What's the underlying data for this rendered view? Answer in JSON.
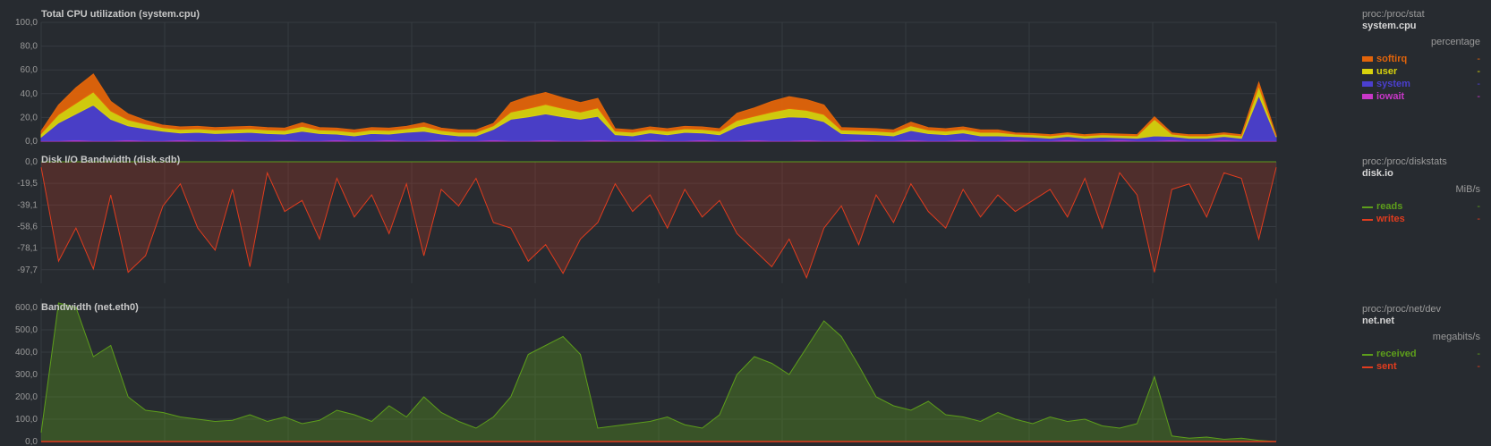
{
  "colors": {
    "background": "#272b30",
    "grid": "#363b41",
    "softirq": "#e2640a",
    "user": "#d8d20d",
    "system": "#4b3fcf",
    "iowait": "#c837c8",
    "reads": "#5d9e1b",
    "writes": "#e13c1e",
    "received": "#5d9e1b",
    "sent": "#e13c1e"
  },
  "charts": [
    {
      "id": "system.cpu",
      "title": "Total CPU utilization (system.cpu)",
      "legend": {
        "context": "proc:/proc/stat",
        "chart": "system.cpu",
        "units": "percentage",
        "dims": [
          {
            "label": "softirq",
            "value": "-",
            "color": "#e2640a"
          },
          {
            "label": "user",
            "value": "-",
            "color": "#d8d20d"
          },
          {
            "label": "system",
            "value": "-",
            "color": "#4b3fcf"
          },
          {
            "label": "iowait",
            "value": "-",
            "color": "#c837c8"
          }
        ]
      },
      "y_ticks": [
        "100,0",
        "80,0",
        "60,0",
        "40,0",
        "20,0",
        "0,0"
      ]
    },
    {
      "id": "disk.io",
      "title": "Disk I/O Bandwidth (disk.sdb)",
      "legend": {
        "context": "proc:/proc/diskstats",
        "chart": "disk.io",
        "units": "MiB/s",
        "dims": [
          {
            "label": "reads",
            "value": "-",
            "color": "#5d9e1b"
          },
          {
            "label": "writes",
            "value": "-",
            "color": "#e13c1e"
          }
        ]
      },
      "y_ticks": [
        "0,0",
        "-19,5",
        "-39,1",
        "-58,6",
        "-78,1",
        "-97,7"
      ]
    },
    {
      "id": "net.net",
      "title": "Bandwidth (net.eth0)",
      "legend": {
        "context": "proc:/proc/net/dev",
        "chart": "net.net",
        "units": "megabits/s",
        "dims": [
          {
            "label": "received",
            "value": "-",
            "color": "#5d9e1b"
          },
          {
            "label": "sent",
            "value": "-",
            "color": "#e13c1e"
          }
        ]
      },
      "y_ticks": [
        "600,0",
        "500,0",
        "400,0",
        "300,0",
        "200,0",
        "100,0",
        "0,0"
      ]
    }
  ],
  "chart_data": [
    {
      "type": "area",
      "title": "Total CPU utilization (system.cpu)",
      "ylabel": "percentage",
      "ylim": [
        0,
        100
      ],
      "stacked": true,
      "series": [
        {
          "name": "iowait",
          "values": [
            0.5,
            0.5,
            1,
            0.5,
            0.5,
            1,
            0.5,
            0.5,
            1,
            0.5,
            0.5,
            1,
            0.5,
            0.5,
            1,
            0.5,
            0.5,
            1,
            0.5,
            0.5,
            1,
            0.5,
            0.5,
            1,
            0.5,
            0.5,
            1,
            0.5,
            0.5,
            1,
            0.5,
            0.5,
            1,
            0.5,
            0.5,
            1,
            0.5,
            0.5,
            1,
            0.5,
            0.5,
            1,
            0.5,
            0.5,
            1,
            0.5,
            0.5,
            1,
            0.5,
            0.5,
            1,
            0.5,
            0.5,
            1,
            0.5,
            0.5,
            1,
            0.5,
            0.5,
            1,
            0.5,
            0.5,
            1,
            0.5,
            0.5,
            1,
            0.5,
            0.5,
            1,
            0.5,
            0.5,
            0.5
          ]
        },
        {
          "name": "system",
          "values": [
            3,
            15,
            22,
            30,
            18,
            12,
            10,
            8,
            6,
            7,
            6,
            6,
            7,
            6,
            5,
            8,
            6,
            5,
            4,
            6,
            5,
            7,
            8,
            5,
            4,
            4,
            9,
            18,
            20,
            22,
            20,
            18,
            20,
            5,
            4,
            6,
            5,
            7,
            6,
            5,
            12,
            15,
            18,
            20,
            19,
            16,
            6,
            5,
            5,
            4,
            8,
            6,
            5,
            6,
            4,
            4,
            3,
            3,
            2,
            3,
            2,
            3,
            2,
            2,
            4,
            3,
            2,
            2,
            3,
            2,
            38,
            3
          ]
        },
        {
          "name": "user",
          "values": [
            3,
            7,
            9,
            11,
            7,
            5,
            4,
            3,
            3,
            3,
            3,
            3,
            3,
            3,
            3,
            4,
            3,
            3,
            3,
            3,
            3,
            3,
            4,
            3,
            3,
            3,
            3,
            6,
            7,
            8,
            7,
            6,
            7,
            3,
            3,
            3,
            3,
            3,
            3,
            3,
            5,
            5,
            6,
            7,
            6,
            6,
            3,
            3,
            3,
            3,
            4,
            3,
            3,
            3,
            3,
            3,
            2,
            2,
            2,
            2,
            2,
            2,
            2,
            2,
            14,
            2,
            2,
            2,
            2,
            2,
            8,
            1
          ]
        },
        {
          "name": "softirq",
          "values": [
            2,
            8,
            13,
            15,
            8,
            5,
            3,
            2,
            2,
            2,
            2,
            2,
            2,
            2,
            2,
            3,
            2,
            2,
            2,
            2,
            2,
            2,
            3,
            2,
            2,
            2,
            2,
            8,
            10,
            10,
            9,
            8,
            8,
            2,
            2,
            2,
            2,
            2,
            2,
            2,
            6,
            7,
            9,
            10,
            9,
            8,
            2,
            2,
            2,
            2,
            3,
            2,
            2,
            2,
            2,
            2,
            1,
            1,
            1,
            1,
            1,
            1,
            1,
            1,
            2,
            1,
            1,
            1,
            1,
            1,
            3,
            0.5
          ]
        }
      ]
    },
    {
      "type": "line",
      "title": "Disk I/O Bandwidth (disk.sdb)",
      "ylabel": "MiB/s",
      "ylim": [
        -110,
        0
      ],
      "series": [
        {
          "name": "reads",
          "values": [
            0,
            0,
            0,
            0,
            0,
            0,
            0,
            0,
            0,
            0,
            0,
            0,
            0,
            0,
            0,
            0,
            0,
            0,
            0,
            0,
            0,
            0,
            0,
            0,
            0,
            0,
            0,
            0,
            0,
            0,
            0,
            0,
            0,
            0,
            0,
            0,
            0,
            0,
            0,
            0,
            0,
            0,
            0,
            0,
            0,
            0,
            0,
            0,
            0,
            0,
            0,
            0,
            0,
            0,
            0,
            0,
            0,
            0,
            0,
            0,
            0,
            0,
            0,
            0,
            0,
            0,
            0,
            0,
            0,
            0,
            0,
            0
          ]
        },
        {
          "name": "writes",
          "values": [
            -5,
            -90,
            -60,
            -97,
            -30,
            -100,
            -85,
            -40,
            -20,
            -60,
            -80,
            -25,
            -95,
            -10,
            -45,
            -35,
            -70,
            -15,
            -50,
            -30,
            -65,
            -20,
            -85,
            -25,
            -40,
            -15,
            -55,
            -60,
            -90,
            -75,
            -101,
            -70,
            -55,
            -20,
            -45,
            -30,
            -60,
            -25,
            -50,
            -35,
            -65,
            -80,
            -95,
            -70,
            -105,
            -60,
            -40,
            -75,
            -30,
            -55,
            -20,
            -45,
            -60,
            -25,
            -50,
            -30,
            -45,
            -35,
            -25,
            -50,
            -15,
            -60,
            -10,
            -30,
            -100,
            -25,
            -20,
            -50,
            -10,
            -15,
            -70,
            -5
          ]
        }
      ]
    },
    {
      "type": "area",
      "title": "Bandwidth (net.eth0)",
      "ylabel": "megabits/s",
      "ylim": [
        0,
        640
      ],
      "series": [
        {
          "name": "received",
          "values": [
            40,
            620,
            600,
            380,
            430,
            200,
            140,
            130,
            110,
            100,
            90,
            95,
            120,
            90,
            110,
            80,
            95,
            140,
            120,
            90,
            160,
            110,
            200,
            130,
            90,
            60,
            110,
            200,
            390,
            430,
            470,
            390,
            60,
            70,
            80,
            90,
            110,
            75,
            60,
            120,
            300,
            380,
            350,
            300,
            420,
            540,
            470,
            340,
            200,
            160,
            140,
            180,
            120,
            110,
            90,
            130,
            100,
            80,
            110,
            90,
            100,
            70,
            60,
            80,
            290,
            25,
            15,
            20,
            10,
            15,
            5,
            0
          ]
        },
        {
          "name": "sent",
          "values": [
            0,
            0,
            0,
            0,
            0,
            0,
            0,
            0,
            0,
            0,
            0,
            0,
            0,
            0,
            0,
            0,
            0,
            0,
            0,
            0,
            0,
            0,
            0,
            0,
            0,
            0,
            0,
            0,
            0,
            0,
            0,
            0,
            0,
            0,
            0,
            0,
            0,
            0,
            0,
            0,
            0,
            0,
            0,
            0,
            0,
            0,
            0,
            0,
            0,
            0,
            0,
            0,
            0,
            0,
            0,
            0,
            0,
            0,
            0,
            0,
            0,
            0,
            0,
            0,
            0,
            0,
            0,
            0,
            0,
            0,
            0,
            0
          ]
        }
      ]
    }
  ]
}
